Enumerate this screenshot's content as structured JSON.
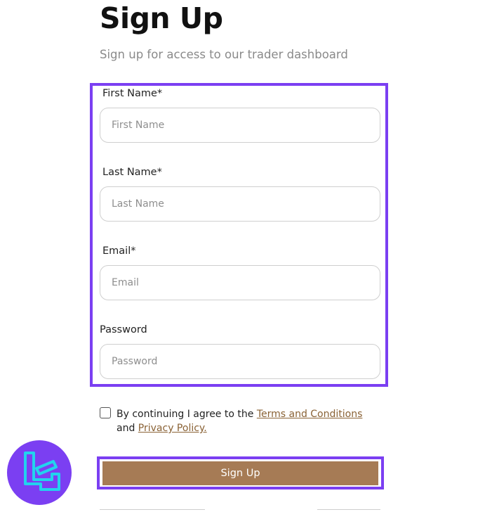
{
  "header": {
    "title": "Sign Up",
    "subtitle": "Sign up for access to our trader dashboard"
  },
  "form": {
    "first_name": {
      "label": "First Name*",
      "placeholder": "First Name"
    },
    "last_name": {
      "label": "Last Name*",
      "placeholder": "Last Name"
    },
    "email": {
      "label": "Email*",
      "placeholder": "Email"
    },
    "password": {
      "label": "Password",
      "placeholder": "Password"
    }
  },
  "agreement": {
    "prefix": "By continuing I agree to the ",
    "terms_link": "Terms and Conditions",
    "middle": " and ",
    "privacy_link": "Privacy Policy."
  },
  "submit": {
    "label": "Sign Up"
  },
  "colors": {
    "highlight": "#7b3ff2",
    "button_bg": "#a67b55",
    "link": "#8a6235",
    "logo_bg": "#7b3ff2",
    "logo_stroke": "#22d3ee"
  },
  "logo": {
    "icon": "tc-logo-icon"
  }
}
